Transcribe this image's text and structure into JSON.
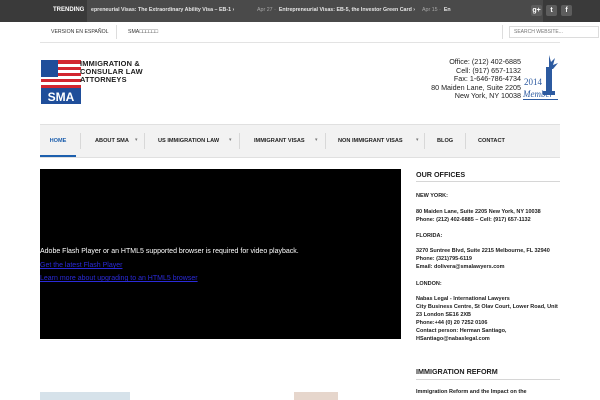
{
  "topbar": {
    "trending_label": "TRENDING",
    "ticker": [
      {
        "date": "",
        "title": "epreneurial Visas: The Extraordinary Ability Visa – EB-1 ›"
      },
      {
        "date": "Apr 27 ·",
        "title": "Entrepreneurial Visas: EB-5, the Investor Green Card ›"
      },
      {
        "date": "Apr 15 ·",
        "title": "En"
      }
    ],
    "social": [
      {
        "icon": "google-plus-icon",
        "glyph": "g+"
      },
      {
        "icon": "twitter-icon",
        "glyph": "t"
      },
      {
        "icon": "facebook-icon",
        "glyph": "f"
      }
    ]
  },
  "utility": {
    "spanish_link": "VERSION EN ESPAÑOL",
    "sma_link": "SMA□□□□□□",
    "search_placeholder": "SEARCH WEBSITE..."
  },
  "header": {
    "logo_initials": "SMA",
    "logo_lines": [
      "IMMIGRATION &",
      "CONSULAR LAW",
      "ATTORNEYS"
    ],
    "contact_lines": [
      "Office: (212) 402-6885",
      "Cell: (917) 657-1132",
      "Fax: 1-646-786-4734",
      "80 Maiden Lane, Suite 2205",
      "New York, NY 10038"
    ],
    "badge_year": "2014",
    "badge_word": "Member",
    "colors": {
      "logo_red": "#d22630",
      "logo_blue": "#1f4e9a",
      "accent": "#1d5fad"
    }
  },
  "nav": {
    "items": [
      {
        "label": "HOME",
        "dropdown": false,
        "active": true
      },
      {
        "label": "ABOUT SMA",
        "dropdown": true,
        "active": false
      },
      {
        "label": "US IMMIGRATION LAW",
        "dropdown": true,
        "active": false
      },
      {
        "label": "IMMIGRANT VISAS",
        "dropdown": true,
        "active": false
      },
      {
        "label": "NON IMMIGRANT VISAS",
        "dropdown": true,
        "active": false
      },
      {
        "label": "BLOG",
        "dropdown": false,
        "active": false
      },
      {
        "label": "CONTACT",
        "dropdown": false,
        "active": false
      }
    ]
  },
  "video": {
    "message": "Adobe Flash Player or an HTML5 supported browser is required for video playback.",
    "link1": "Get the latest Flash Player",
    "link2": "Learn more about upgrading to an HTML5 browser"
  },
  "sidebar": {
    "offices_heading": "OUR OFFICES",
    "ny_label": "NEW YORK:",
    "ny_address": "80 Maiden Lane, Suite 2205 New York, NY 10038",
    "ny_phone": "Phone: (212) 402-6885 – Cell: (917) 657-1132",
    "fl_label": "FLORIDA:",
    "fl_address": "3270 Suntree Blvd, Suite 2215 Melbourne, FL 32940",
    "fl_phone": "Phone: (321)795-6119",
    "fl_email": "Email: dolivera@smalawyers.com",
    "ldn_label": "LONDON:",
    "ldn_name": "Nabas Legal - International Lawyers",
    "ldn_line1": "City Business Centre, St Olav Court, Lower Road, Unit",
    "ldn_line2": "23 London SE16 2XB",
    "ldn_phone": "Phone:+44 (0) 20 7252 0106",
    "ldn_contact": "Contact person: Herman Santiago,",
    "ldn_email": "HSantiago@nabaslegal.com",
    "reform_heading": "IMMIGRATION REFORM",
    "reform_post": "Immigration Reform and the Impact on the"
  }
}
